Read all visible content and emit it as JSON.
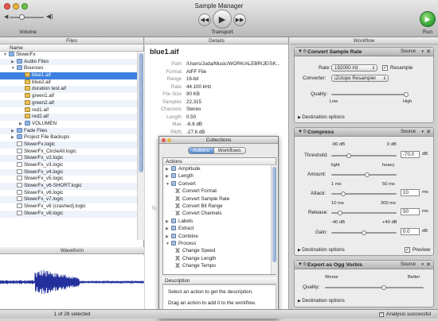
{
  "window": {
    "title": "Sample Manager"
  },
  "toolbar": {
    "volume_label": "Volume",
    "transport_label": "Transport",
    "run_label": "Run",
    "volume_level": 0.35
  },
  "panes": {
    "files": "Files",
    "details": "Details",
    "workflow": "Workflow"
  },
  "files": {
    "column_name": "Name",
    "rows": [
      {
        "label": "SkwerFx",
        "type": "folder",
        "indent": 0,
        "open": true
      },
      {
        "label": "Audio Files",
        "type": "folder",
        "indent": 1,
        "open": false
      },
      {
        "label": "Bounces",
        "type": "folder",
        "indent": 1,
        "open": true
      },
      {
        "label": "blue1.aif",
        "type": "audio",
        "indent": 2,
        "selected": true
      },
      {
        "label": "blue2.aif",
        "type": "audio",
        "indent": 2
      },
      {
        "label": "duration test.aif",
        "type": "audio",
        "indent": 2
      },
      {
        "label": "green1.aif",
        "type": "audio",
        "indent": 2
      },
      {
        "label": "green2.aif",
        "type": "audio",
        "indent": 2
      },
      {
        "label": "red1.aif",
        "type": "audio",
        "indent": 2
      },
      {
        "label": "red2.aif",
        "type": "audio",
        "indent": 2
      },
      {
        "label": "VOLUMEN",
        "type": "folder",
        "indent": 2,
        "open": false
      },
      {
        "label": "Fade Files",
        "type": "folder",
        "indent": 1,
        "open": false
      },
      {
        "label": "Project File Backups",
        "type": "folder",
        "indent": 1,
        "open": false
      },
      {
        "label": "SkwerFx.logic",
        "type": "doc",
        "indent": 1
      },
      {
        "label": "SkwerFx_CircleAll.logic",
        "type": "doc",
        "indent": 1
      },
      {
        "label": "SkwerFx_v2.logic",
        "type": "doc",
        "indent": 1
      },
      {
        "label": "SkwerFx_v3.logic",
        "type": "doc",
        "indent": 1
      },
      {
        "label": "SkwerFx_v4.logic",
        "type": "doc",
        "indent": 1
      },
      {
        "label": "SkwerFx_v5.logic",
        "type": "doc",
        "indent": 1
      },
      {
        "label": "SkwerFx_v6-SHORT.logic",
        "type": "doc",
        "indent": 1
      },
      {
        "label": "SkwerFx_v6.logic",
        "type": "doc",
        "indent": 1
      },
      {
        "label": "SkwerFx_v7.logic",
        "type": "doc",
        "indent": 1
      },
      {
        "label": "SkwerFx_v8 (crashed).logic",
        "type": "doc",
        "indent": 1
      },
      {
        "label": "SkwerFx_v8.logic",
        "type": "doc",
        "indent": 1
      }
    ],
    "waveform_label": "Waveform",
    "selection_status": "1 of 28 selected"
  },
  "details": {
    "filename": "blue1.aif",
    "rows": [
      {
        "key": "Path",
        "value": "/Users/Juda/Music/WORK/ALEBRIJE/SK..."
      },
      {
        "key": "Format",
        "value": "AIFF File"
      },
      {
        "key": "Range",
        "value": "16-bit"
      },
      {
        "key": "Rate",
        "value": "44.100 kHz"
      },
      {
        "key": "File Size",
        "value": "90 KB"
      },
      {
        "key": "Samples",
        "value": "22,315"
      },
      {
        "key": "Channels",
        "value": "Stereo"
      },
      {
        "key": "Length",
        "value": "0.50"
      },
      {
        "key": "Max",
        "value": "-6.6 dB"
      },
      {
        "key": "RMS",
        "value": "-27.6 dB"
      }
    ]
  },
  "collections": {
    "title": "Collections",
    "tabs": [
      "Actions",
      "Workflows"
    ],
    "active_tab": "Actions",
    "list_header": "Actions",
    "items": [
      {
        "label": "Amplitude",
        "kind": "group",
        "indent": 0,
        "open": false
      },
      {
        "label": "Length",
        "kind": "group",
        "indent": 0,
        "open": false
      },
      {
        "label": "Convert",
        "kind": "group",
        "indent": 0,
        "open": true
      },
      {
        "label": "Convert Format",
        "kind": "action",
        "indent": 1
      },
      {
        "label": "Convert Sample Rate",
        "kind": "action",
        "indent": 1
      },
      {
        "label": "Convert Bit Range",
        "kind": "action",
        "indent": 1
      },
      {
        "label": "Convert Channels",
        "kind": "action",
        "indent": 1
      },
      {
        "label": "Labels",
        "kind": "group",
        "indent": 0,
        "open": false
      },
      {
        "label": "Extract",
        "kind": "group",
        "indent": 0,
        "open": false
      },
      {
        "label": "Combine",
        "kind": "group",
        "indent": 0,
        "open": false
      },
      {
        "label": "Process",
        "kind": "group",
        "indent": 0,
        "open": true
      },
      {
        "label": "Change Speed",
        "kind": "action",
        "indent": 1
      },
      {
        "label": "Change Length",
        "kind": "action",
        "indent": 1
      },
      {
        "label": "Change Tempo",
        "kind": "action",
        "indent": 1
      }
    ],
    "description_header": "Description",
    "description_lines": [
      "Select an action to get the description.",
      "Drag an action to add it to the workflow."
    ]
  },
  "workflow": {
    "source_label": "Source",
    "convert": {
      "title": "Convert Sample Rate",
      "rate_label": "Rate:",
      "rate_value": "192000 Hz",
      "resample_label": "Resample",
      "converter_label": "Converter:",
      "converter_value": "iZotope Resampler",
      "quality_label": "Quality:",
      "quality_low": "Low",
      "quality_high": "High",
      "quality_level": 0.98,
      "dest": "Destination options"
    },
    "compress": {
      "title": "Compress",
      "threshold_min": "-96 dB",
      "threshold_max": "0 dB",
      "threshold_label": "Threshold:",
      "threshold_value": "-70.0",
      "threshold_unit": "dB",
      "amount_light": "light",
      "amount_heavy": "heavy",
      "amount_label": "Amount:",
      "attack_min": "1 ms",
      "attack_max": "50 ms",
      "attack_label": "Attack:",
      "attack_value": "10",
      "attack_unit": "ms",
      "release_min": "10 ms",
      "release_max": "300 ms",
      "release_label": "Release:",
      "release_value": "50",
      "release_unit": "ms",
      "gain_min": "-40 dB",
      "gain_max": "+40 dB",
      "gain_label": "Gain:",
      "gain_value": "0.0",
      "gain_unit": "dB",
      "threshold_level": 0.27,
      "amount_level": 0.55,
      "attack_level": 0.18,
      "release_level": 0.14,
      "gain_level": 0.5,
      "dest": "Destination options",
      "preview_label": "Preview"
    },
    "ogg": {
      "title": "Export as Ogg Vorbis",
      "worse": "Worse",
      "better": "Better",
      "quality_label": "Quality:",
      "quality_level": 0.6,
      "dest": "Destination options"
    }
  },
  "status": {
    "text": "Analysis successful"
  },
  "colors": {
    "selection": "#3d80df",
    "waveform": "#23309c",
    "accent_green": "#3aa73a"
  }
}
